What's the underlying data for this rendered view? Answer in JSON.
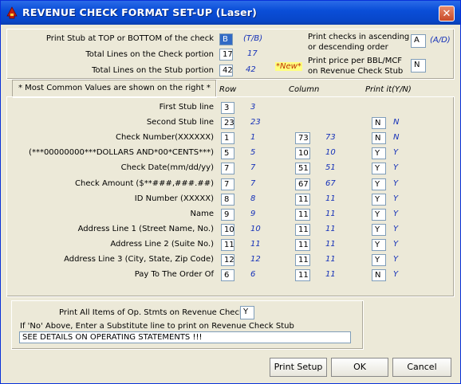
{
  "window": {
    "title": "REVENUE CHECK FORMAT SET-UP (Laser)",
    "close_glyph": "✕"
  },
  "top": {
    "stub_pos_label": "Print Stub at TOP or BOTTOM of the check",
    "stub_pos_value": "B",
    "stub_pos_hint": "(T/B)",
    "check_lines_label": "Total Lines on the Check portion",
    "check_lines_value": "17",
    "check_lines_hint": "17",
    "stub_lines_label": "Total Lines on the Stub portion",
    "stub_lines_value": "42",
    "stub_lines_hint": "42",
    "order_label_1": "Print checks in ascending",
    "order_label_2": "or descending order",
    "order_value": "A",
    "order_hint": "(A/D)",
    "new_badge": "*New*",
    "price_label_1": "Print price per BBL/MCF",
    "price_label_2": "on Revenue Check Stub",
    "price_value": "N"
  },
  "columns": {
    "note": "* Most Common Values are shown on the right *",
    "row": "Row",
    "column": "Column",
    "print": "Print it(Y/N)"
  },
  "rows": [
    {
      "label": "First Stub line",
      "row": "3",
      "row_hint": "3",
      "col": "",
      "col_hint": "",
      "print": "",
      "print_hint": ""
    },
    {
      "label": "Second Stub line",
      "row": "23",
      "row_hint": "23",
      "col": "",
      "col_hint": "",
      "print": "N",
      "print_hint": "N"
    },
    {
      "label": "Check Number(XXXXXX)",
      "row": "1",
      "row_hint": "1",
      "col": "73",
      "col_hint": "73",
      "print": "N",
      "print_hint": "N"
    },
    {
      "label": "(***00000000***DOLLARS AND*00*CENTS***)",
      "row": "5",
      "row_hint": "5",
      "col": "10",
      "col_hint": "10",
      "print": "Y",
      "print_hint": "Y"
    },
    {
      "label": "Check Date(mm/dd/yy)",
      "row": "7",
      "row_hint": "7",
      "col": "51",
      "col_hint": "51",
      "print": "Y",
      "print_hint": "Y"
    },
    {
      "label": "Check Amount ($**###,###.##)",
      "row": "7",
      "row_hint": "7",
      "col": "67",
      "col_hint": "67",
      "print": "Y",
      "print_hint": "Y"
    },
    {
      "label": "ID Number (XXXXX)",
      "row": "8",
      "row_hint": "8",
      "col": "11",
      "col_hint": "11",
      "print": "Y",
      "print_hint": "Y"
    },
    {
      "label": "Name",
      "row": "9",
      "row_hint": "9",
      "col": "11",
      "col_hint": "11",
      "print": "Y",
      "print_hint": "Y"
    },
    {
      "label": "Address Line 1 (Street Name, No.)",
      "row": "10",
      "row_hint": "10",
      "col": "11",
      "col_hint": "11",
      "print": "Y",
      "print_hint": "Y"
    },
    {
      "label": "Address Line 2 (Suite No.)",
      "row": "11",
      "row_hint": "11",
      "col": "11",
      "col_hint": "11",
      "print": "Y",
      "print_hint": "Y"
    },
    {
      "label": "Address Line 3 (City, State, Zip Code)",
      "row": "12",
      "row_hint": "12",
      "col": "11",
      "col_hint": "11",
      "print": "Y",
      "print_hint": "Y"
    },
    {
      "label": "Pay To The Order Of",
      "row": "6",
      "row_hint": "6",
      "col": "11",
      "col_hint": "11",
      "print": "N",
      "print_hint": "Y"
    }
  ],
  "bottom": {
    "print_all_label": "Print All Items of Op. Stmts on Revenue Check",
    "print_all_value": "Y",
    "substitute_label": "If 'No' Above, Enter a Substitute line to print on Revenue Check Stub",
    "substitute_value": "SEE DETAILS ON OPERATING STATEMENTS !!!"
  },
  "buttons": {
    "print_setup": "Print Setup",
    "ok": "OK",
    "cancel": "Cancel"
  }
}
